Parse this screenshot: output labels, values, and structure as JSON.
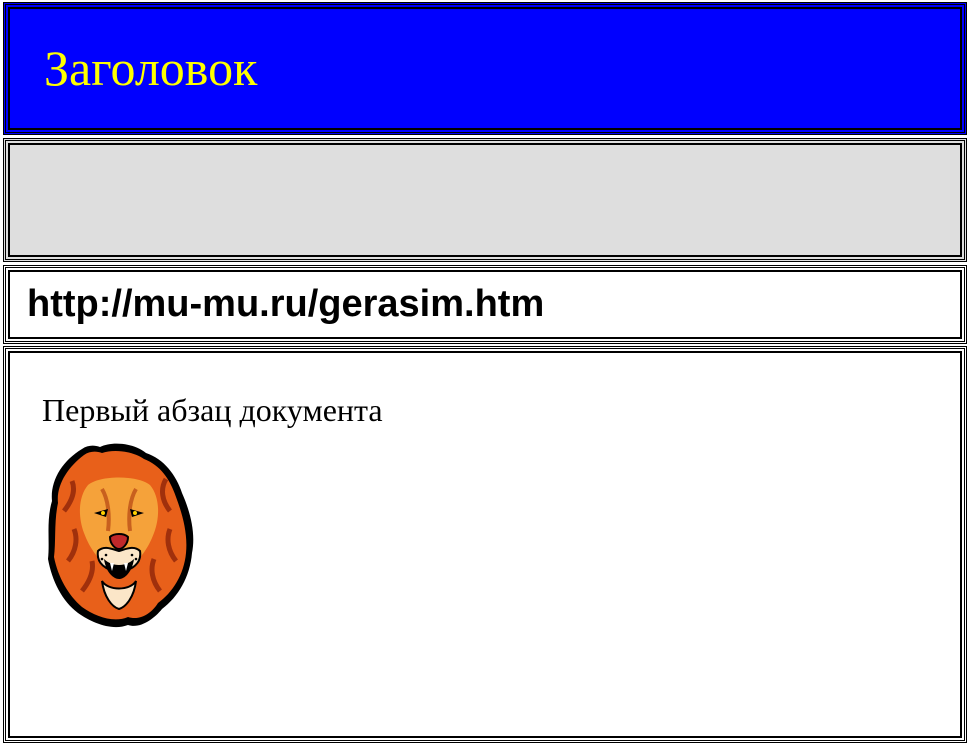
{
  "title": "Заголовок",
  "url": "http://mu-mu.ru/gerasim.htm",
  "paragraph": "Первый абзац документа",
  "image": {
    "icon": "lion-icon"
  },
  "colors": {
    "title_bg": "#0000ff",
    "title_text": "#ffff00",
    "gray_panel": "#dedede",
    "border": "#000000"
  }
}
